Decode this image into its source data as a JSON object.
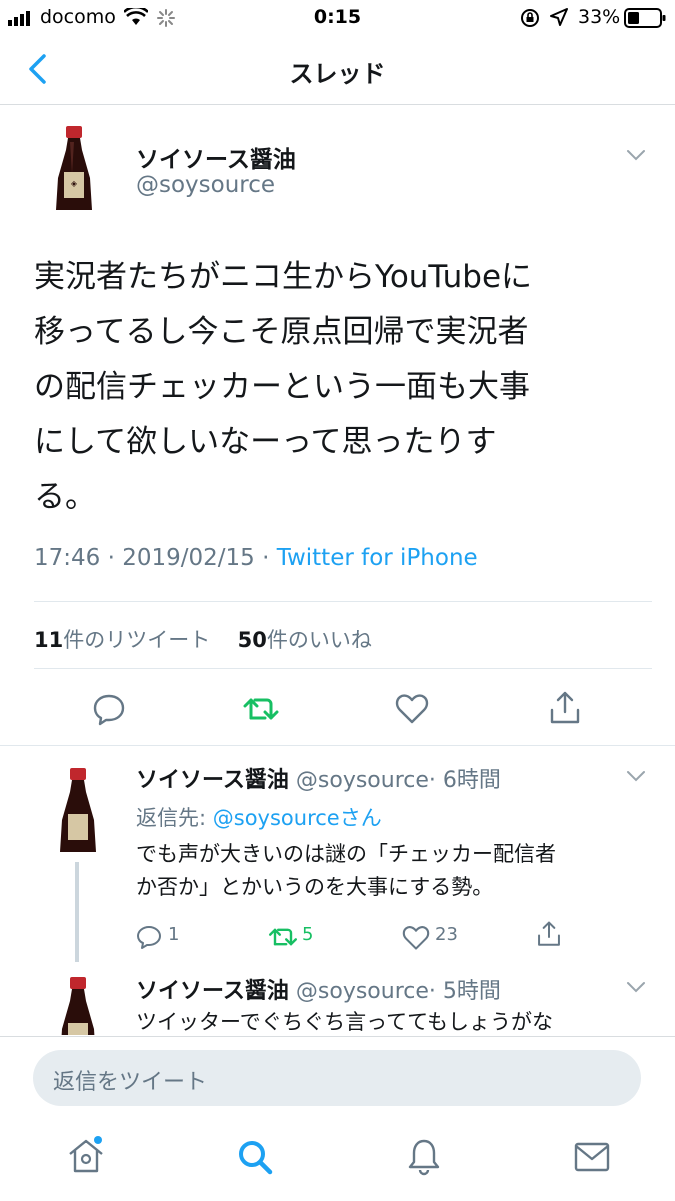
{
  "status_bar": {
    "carrier": "docomo",
    "time": "0:15",
    "battery": "33%"
  },
  "header": {
    "back_icon": "chevron-left-icon",
    "title": "スレッド"
  },
  "main_tweet": {
    "display_name": "ソイソース醤油",
    "handle": "@soysource",
    "lines": [
      "実況者たちがニコ生からYouTubeに",
      "移ってるし今こそ原点回帰で実況者",
      "の配信チェッカーという一面も大事",
      "にして欲しいなーって思ったりす",
      "る。"
    ],
    "timestamp": "17:46 · 2019/02/15 · ",
    "source": "Twitter for iPhone",
    "retweet_count": "11",
    "retweet_label": "件のリツイート",
    "like_count": "50",
    "like_label": "件のいいね"
  },
  "replies": [
    {
      "display_name": "ソイソース醤油",
      "handle": "@soysource",
      "time": "· 6時間",
      "reply_to_prefix": "返信先: ",
      "reply_to_handle": "@soysourceさん",
      "lines": [
        "でも声が大きいのは謎の「チェッカー配信者",
        "か否か」とかいうのを大事にする勢。"
      ],
      "reply_count": "1",
      "retweet_count": "5",
      "like_count": "23"
    },
    {
      "display_name": "ソイソース醤油",
      "handle": "@soysource",
      "time": "· 5時間",
      "lines": [
        "ツイッターでぐちぐち言っててもしょうがな"
      ]
    }
  ],
  "compose": {
    "placeholder": "返信をツイート"
  },
  "tab_bar": {
    "items": [
      "home-icon",
      "search-icon",
      "notifications-icon",
      "messages-icon"
    ],
    "active": "search-icon"
  },
  "colors": {
    "accent": "#1da1f2",
    "retweet_green": "#17bf63",
    "secondary_text": "#657786"
  }
}
